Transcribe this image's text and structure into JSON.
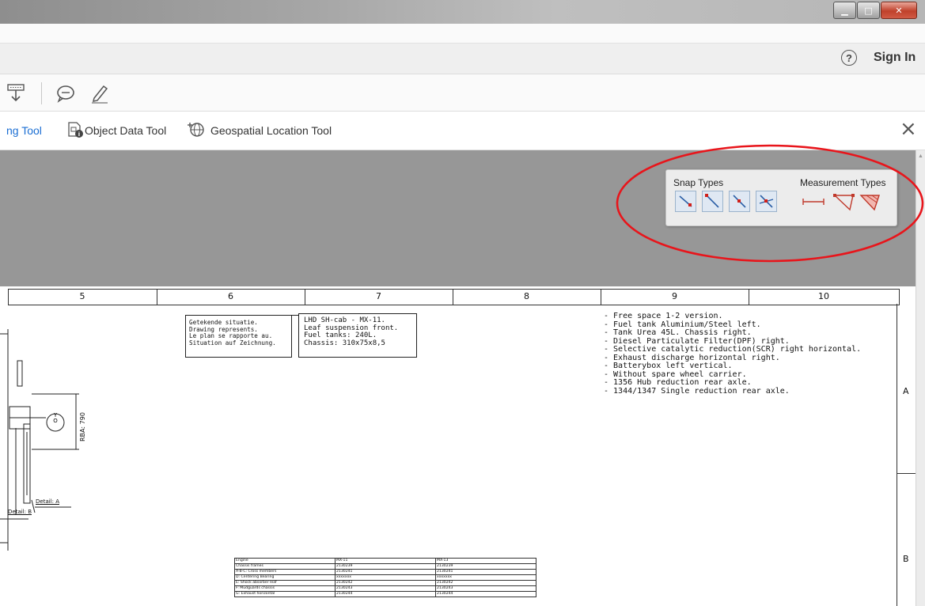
{
  "window": {
    "controls": [
      "minimize",
      "maximize",
      "close"
    ]
  },
  "header": {
    "help_symbol": "?",
    "sign_in": "Sign In"
  },
  "toolbar": {
    "icons": [
      "save-to-device-icon",
      "comment-icon",
      "highlight-pen-icon"
    ]
  },
  "tools_bar": {
    "items": [
      {
        "label": "ng Tool",
        "icon": "measuring-tool-icon"
      },
      {
        "label": "Object Data Tool",
        "icon": "object-data-tool-icon"
      },
      {
        "label": "Geospatial Location Tool",
        "icon": "geospatial-location-icon"
      }
    ],
    "close_symbol": "×"
  },
  "measurement_panel": {
    "snap_title": "Snap Types",
    "measurement_title": "Measurement Types",
    "snap_types": [
      "snap-to-path-icon",
      "snap-to-endpoint-icon",
      "snap-to-midpoint-icon",
      "snap-to-intersection-icon"
    ],
    "measurement_types": [
      "distance-icon",
      "perimeter-icon",
      "area-icon"
    ],
    "highlight_color": "#e8151b"
  },
  "document": {
    "ruler": [
      "5",
      "6",
      "7",
      "8",
      "9",
      "10"
    ],
    "zones": [
      "A",
      "B"
    ],
    "note_left": [
      "Getekende situatie.",
      "Drawing represents.",
      "Le plan se rapporte au.",
      "Situation auf Zeichnung."
    ],
    "note_right": [
      "LHD SH-cab - MX-11.",
      "Leaf suspension front.",
      "Fuel tanks: 240L.",
      "Chassis: 310x75x8,5"
    ],
    "specs": [
      "- Free space 1-2 version.",
      "- Fuel tank Aluminium/Steel left.",
      "- Tank Urea 45L. Chassis right.",
      "- Diesel Particulate Filter(DPF) right.",
      "- Selective catalytic reduction(SCR) right horizontal.",
      "- Exhaust discharge horizontal right.",
      "- Batterybox left vertical.",
      "- Without spare wheel carrier.",
      "- 1356 Hub reduction rear axle.",
      "- 1344/1347 Single reduction rear axle."
    ],
    "detail_a": "Detail: A",
    "detail_b": "Detail: B",
    "dimension": "RBA: 790",
    "symbol": "Y\nO",
    "parts_table": [
      [
        "Engine",
        "MX-11",
        "MX-13"
      ],
      [
        "Chassis frames",
        "2130239",
        "2130239"
      ],
      [
        "A-B-C: Cross members",
        "2130241",
        "2130241"
      ],
      [
        "D: Centering Bearing",
        "xxxxxxx",
        "xxxxxxx"
      ],
      [
        "E: Shock absorber leaf",
        "2130242",
        "2130242"
      ],
      [
        "F: Mudguards chassis",
        "2130243",
        "2130243"
      ],
      [
        "G: Exhaust horizontal",
        "2130244",
        "2130244"
      ]
    ]
  }
}
